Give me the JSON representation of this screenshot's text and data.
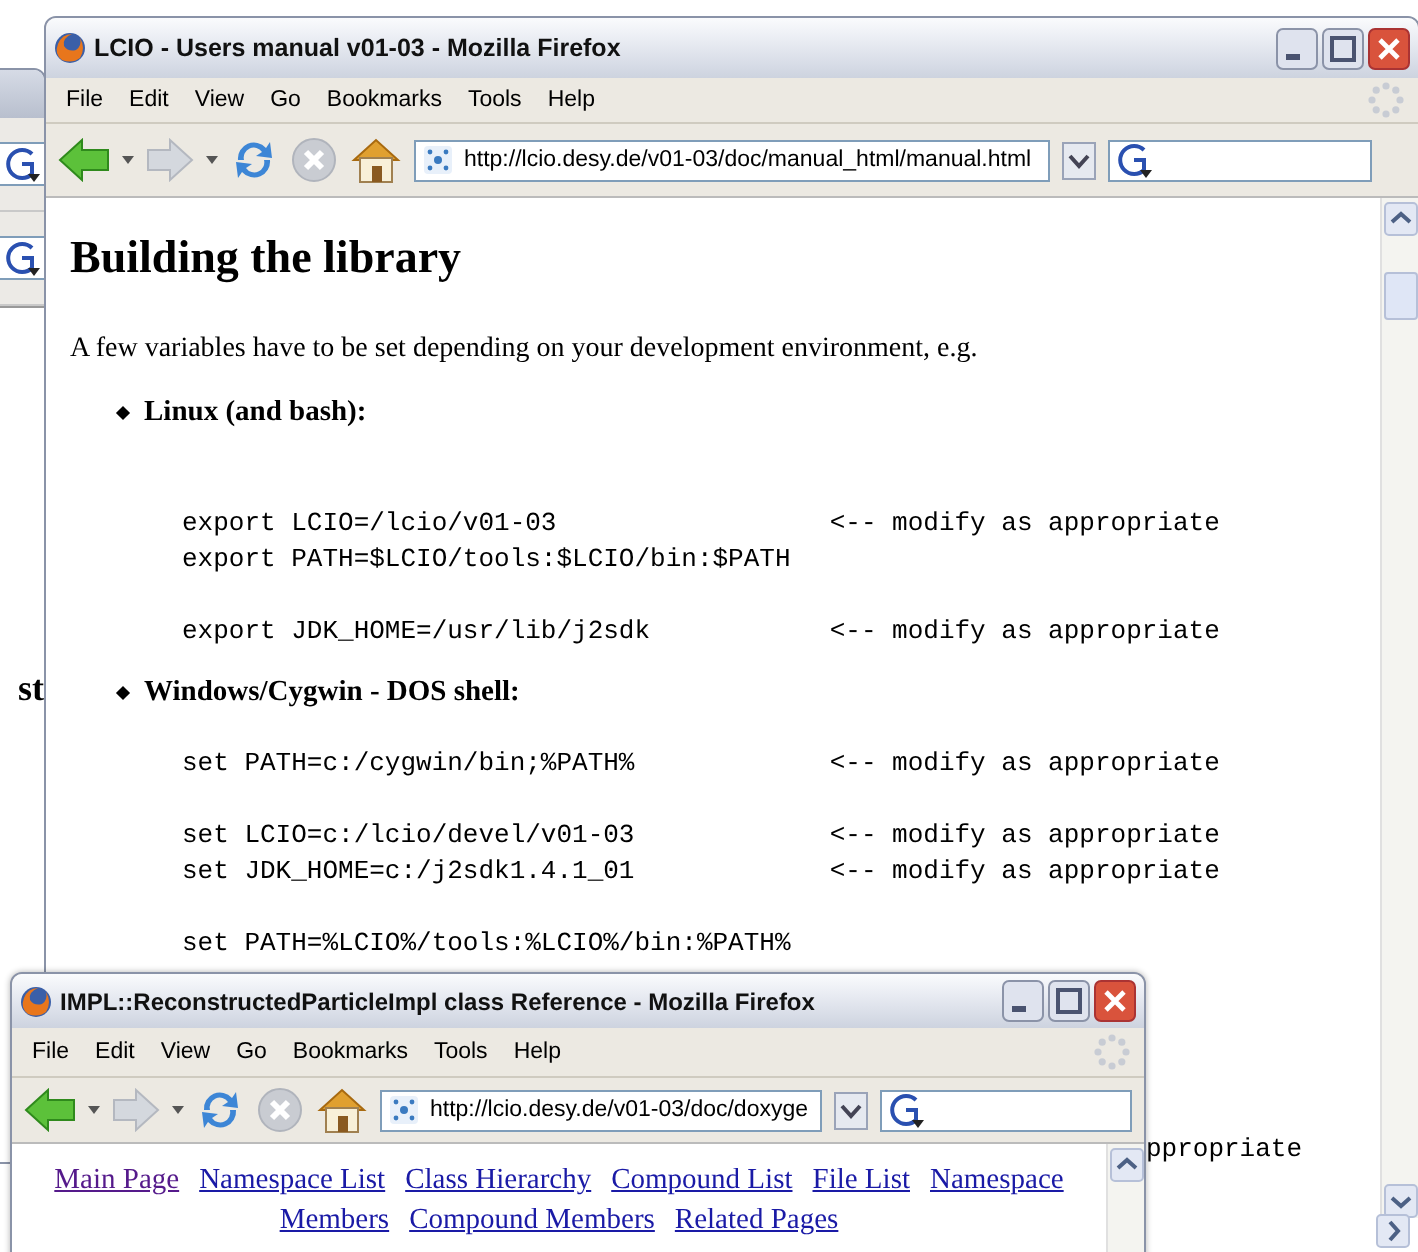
{
  "back_window": {
    "text_fragment": "st"
  },
  "main_window": {
    "title": "LCIO - Users manual v01-03 - Mozilla Firefox",
    "menu": [
      "File",
      "Edit",
      "View",
      "Go",
      "Bookmarks",
      "Tools",
      "Help"
    ],
    "address": "http://lcio.desy.de/v01-03/doc/manual_html/manual.html",
    "page": {
      "heading": "Building the library",
      "intro": "A few variables have to be set depending on your development environment, e.g.",
      "sections": [
        {
          "label": "Linux (and bash):",
          "groups": [
            [
              {
                "command": "export LCIO=/lcio/v01-03",
                "note": "<-- modify as appropriate"
              },
              {
                "command": "export PATH=$LCIO/tools:$LCIO/bin:$PATH"
              }
            ],
            [
              {
                "command": "export JDK_HOME=/usr/lib/j2sdk",
                "note": "<-- modify as appropriate"
              }
            ]
          ]
        },
        {
          "label": "Windows/Cygwin - DOS shell:",
          "groups": [
            [
              {
                "command": "set PATH=c:/cygwin/bin;%PATH%",
                "note": "<-- modify as appropriate"
              }
            ],
            [
              {
                "command": "set LCIO=c:/lcio/devel/v01-03",
                "note": "<-- modify as appropriate"
              },
              {
                "command": "set JDK_HOME=c:/j2sdk1.4.1_01",
                "note": "<-- modify as appropriate"
              }
            ],
            [
              {
                "command": "set PATH=%LCIO%/tools:%LCIO%/bin:%PATH%"
              }
            ]
          ]
        }
      ],
      "fragment": "ppropriate"
    }
  },
  "front_window": {
    "title": "IMPL::ReconstructedParticleImpl class Reference - Mozilla Firefox",
    "menu": [
      "File",
      "Edit",
      "View",
      "Go",
      "Bookmarks",
      "Tools",
      "Help"
    ],
    "address": "http://lcio.desy.de/v01-03/doc/doxyge",
    "nav_links": [
      [
        {
          "label": "Main Page",
          "visited": true
        },
        {
          "label": "Namespace List",
          "visited": false
        },
        {
          "label": "Class Hierarchy",
          "visited": false
        },
        {
          "label": "Compound List",
          "visited": false
        },
        {
          "label": "File List",
          "visited": false
        },
        {
          "label": "Namespace",
          "visited": false
        }
      ],
      [
        {
          "label": "Members",
          "visited": false
        },
        {
          "label": "Compound Members",
          "visited": false
        },
        {
          "label": "Related Pages",
          "visited": false
        }
      ]
    ]
  }
}
